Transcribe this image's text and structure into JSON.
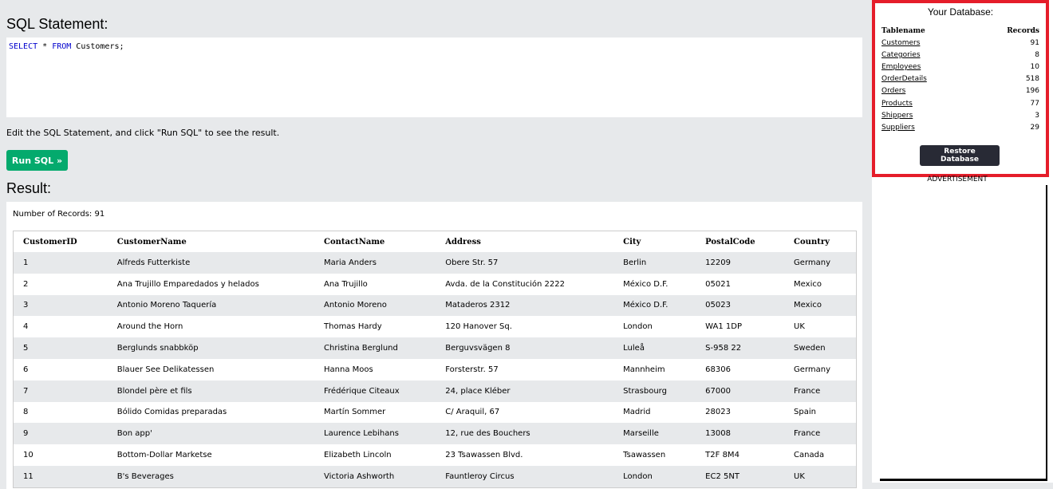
{
  "editor": {
    "heading": "SQL Statement:",
    "kw_select": "SELECT",
    "star": " * ",
    "kw_from": "FROM",
    "rest": " Customers;",
    "hint": "Edit the SQL Statement, and click \"Run SQL\" to see the result.",
    "run_label": "Run SQL »"
  },
  "result": {
    "heading": "Result:",
    "count": "Number of Records: 91",
    "columns": [
      "CustomerID",
      "CustomerName",
      "ContactName",
      "Address",
      "City",
      "PostalCode",
      "Country"
    ],
    "rows": [
      [
        "1",
        "Alfreds Futterkiste",
        "Maria Anders",
        "Obere Str. 57",
        "Berlin",
        "12209",
        "Germany"
      ],
      [
        "2",
        "Ana Trujillo Emparedados y helados",
        "Ana Trujillo",
        "Avda. de la Constitución 2222",
        "México D.F.",
        "05021",
        "Mexico"
      ],
      [
        "3",
        "Antonio Moreno Taquería",
        "Antonio Moreno",
        "Mataderos 2312",
        "México D.F.",
        "05023",
        "Mexico"
      ],
      [
        "4",
        "Around the Horn",
        "Thomas Hardy",
        "120 Hanover Sq.",
        "London",
        "WA1 1DP",
        "UK"
      ],
      [
        "5",
        "Berglunds snabbköp",
        "Christina Berglund",
        "Berguvsvägen 8",
        "Luleå",
        "S-958 22",
        "Sweden"
      ],
      [
        "6",
        "Blauer See Delikatessen",
        "Hanna Moos",
        "Forsterstr. 57",
        "Mannheim",
        "68306",
        "Germany"
      ],
      [
        "7",
        "Blondel père et fils",
        "Frédérique Citeaux",
        "24, place Kléber",
        "Strasbourg",
        "67000",
        "France"
      ],
      [
        "8",
        "Bólido Comidas preparadas",
        "Martín Sommer",
        "C/ Araquil, 67",
        "Madrid",
        "28023",
        "Spain"
      ],
      [
        "9",
        "Bon app'",
        "Laurence Lebihans",
        "12, rue des Bouchers",
        "Marseille",
        "13008",
        "France"
      ],
      [
        "10",
        "Bottom-Dollar Marketse",
        "Elizabeth Lincoln",
        "23 Tsawassen Blvd.",
        "Tsawassen",
        "T2F 8M4",
        "Canada"
      ],
      [
        "11",
        "B's Beverages",
        "Victoria Ashworth",
        "Fauntleroy Circus",
        "London",
        "EC2 5NT",
        "UK"
      ]
    ]
  },
  "database": {
    "title": "Your Database:",
    "col_table": "Tablename",
    "col_records": "Records",
    "tables": [
      {
        "name": "Customers",
        "records": "91"
      },
      {
        "name": "Categories",
        "records": "8"
      },
      {
        "name": "Employees",
        "records": "10"
      },
      {
        "name": "OrderDetails",
        "records": "518"
      },
      {
        "name": "Orders",
        "records": "196"
      },
      {
        "name": "Products",
        "records": "77"
      },
      {
        "name": "Shippers",
        "records": "3"
      },
      {
        "name": "Suppliers",
        "records": "29"
      }
    ],
    "restore_label": "Restore Database",
    "advertisement": "ADVERTISEMENT"
  },
  "colors": {
    "run_button": "#04aa6d",
    "restore_button": "#282a35",
    "db_border": "#e51d2a",
    "keyword": "#0000cd"
  }
}
